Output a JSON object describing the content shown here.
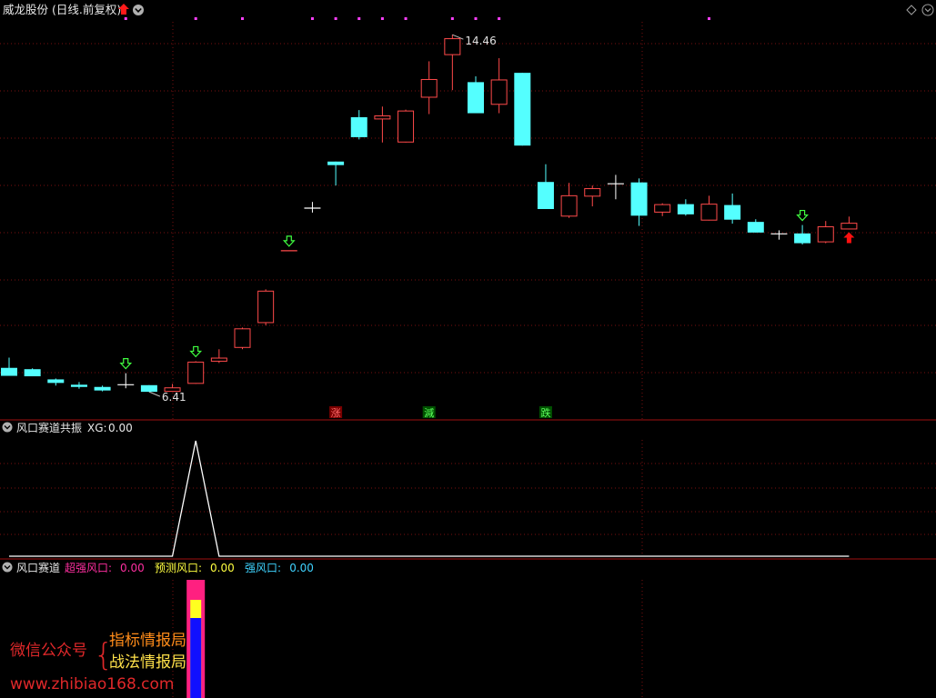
{
  "header": {
    "title": "威龙股份 (日线.前复权)",
    "diamond_icon": "diamond-icon"
  },
  "price_pane": {
    "candles": [
      {
        "o": 6.95,
        "h": 7.18,
        "l": 6.77,
        "c": 6.77
      },
      {
        "o": 6.92,
        "h": 6.94,
        "l": 6.76,
        "c": 6.76
      },
      {
        "o": 6.69,
        "h": 6.71,
        "l": 6.55,
        "c": 6.61
      },
      {
        "o": 6.57,
        "h": 6.63,
        "l": 6.48,
        "c": 6.52
      },
      {
        "o": 6.52,
        "h": 6.55,
        "l": 6.42,
        "c": 6.44
      },
      {
        "o": 6.57,
        "h": 6.83,
        "l": 6.49,
        "c": 6.57
      },
      {
        "o": 6.56,
        "h": 6.56,
        "l": 6.41,
        "c": 6.41
      },
      {
        "o": 6.41,
        "h": 6.59,
        "l": 6.41,
        "c": 6.51
      },
      {
        "o": 6.59,
        "h": 7.1,
        "l": 6.59,
        "c": 7.09
      },
      {
        "o": 7.09,
        "h": 7.37,
        "l": 7.06,
        "c": 7.18
      },
      {
        "o": 7.4,
        "h": 7.86,
        "l": 7.37,
        "c": 7.84
      },
      {
        "o": 7.96,
        "h": 8.72,
        "l": 7.91,
        "c": 8.69
      },
      {
        "o": 9.59,
        "h": 9.59,
        "l": 9.59,
        "c": 9.59
      },
      {
        "o": 10.55,
        "h": 10.69,
        "l": 10.45,
        "c": 10.55
      },
      {
        "o": 11.6,
        "h": 11.6,
        "l": 11.06,
        "c": 11.52
      },
      {
        "o": 12.6,
        "h": 12.76,
        "l": 12.1,
        "c": 12.15
      },
      {
        "o": 12.55,
        "h": 12.84,
        "l": 12.03,
        "c": 12.64
      },
      {
        "o": 12.03,
        "h": 12.77,
        "l": 12.03,
        "c": 12.75
      },
      {
        "o": 13.04,
        "h": 13.86,
        "l": 12.67,
        "c": 13.46
      },
      {
        "o": 14.0,
        "h": 14.46,
        "l": 13.21,
        "c": 14.38
      },
      {
        "o": 13.39,
        "h": 13.52,
        "l": 12.69,
        "c": 12.69
      },
      {
        "o": 12.88,
        "h": 13.93,
        "l": 12.69,
        "c": 13.45
      },
      {
        "o": 13.6,
        "h": 13.6,
        "l": 11.96,
        "c": 11.96
      },
      {
        "o": 11.14,
        "h": 11.54,
        "l": 10.53,
        "c": 10.53
      },
      {
        "o": 10.36,
        "h": 11.12,
        "l": 10.33,
        "c": 10.84
      },
      {
        "o": 10.81,
        "h": 11.06,
        "l": 10.59,
        "c": 11.0
      },
      {
        "o": 11.1,
        "h": 11.3,
        "l": 10.75,
        "c": 11.1
      },
      {
        "o": 11.13,
        "h": 11.22,
        "l": 10.15,
        "c": 10.38
      },
      {
        "o": 10.45,
        "h": 10.66,
        "l": 10.37,
        "c": 10.64
      },
      {
        "o": 10.64,
        "h": 10.75,
        "l": 10.38,
        "c": 10.41
      },
      {
        "o": 10.27,
        "h": 10.83,
        "l": 10.27,
        "c": 10.65
      },
      {
        "o": 10.62,
        "h": 10.88,
        "l": 10.2,
        "c": 10.29
      },
      {
        "o": 10.24,
        "h": 10.3,
        "l": 10.0,
        "c": 10.0
      },
      {
        "o": 9.97,
        "h": 10.05,
        "l": 9.84,
        "c": 9.97
      },
      {
        "o": 9.98,
        "h": 10.17,
        "l": 9.73,
        "c": 9.76
      },
      {
        "o": 9.78,
        "h": 10.26,
        "l": 9.76,
        "c": 10.14
      },
      {
        "o": 10.07,
        "h": 10.36,
        "l": 10.07,
        "c": 10.22
      }
    ],
    "ylim": [
      5.9,
      14.75
    ],
    "high_label": "14.46",
    "low_label": "6.41",
    "signal_down_arrows": [
      5,
      8,
      12,
      34
    ],
    "signal_up_arrows": [
      36
    ],
    "marker_flags": [
      {
        "index": 14,
        "text": "涨",
        "bg": "#7a0000",
        "fg": "#ff6a6a"
      },
      {
        "index": 18,
        "text": "減",
        "bg": "#005000",
        "fg": "#5dff5d"
      },
      {
        "index": 23,
        "text": "跌",
        "bg": "#005000",
        "fg": "#5dff5d"
      }
    ],
    "top_dots": [
      5,
      8,
      10,
      13,
      14,
      15,
      16,
      17,
      19,
      20,
      21,
      30
    ]
  },
  "indicator_pane": {
    "name": "风口赛道共振",
    "xg_label": "XG:",
    "xg_value": "0.00",
    "peak_index": 8,
    "line_values": {
      "base": 0,
      "peak": 1
    }
  },
  "bottom_pane": {
    "name": "风口赛道",
    "legend": [
      {
        "label": "超强风口:",
        "value": "0.00",
        "color": "#ff2fa0"
      },
      {
        "label": "预测风口:",
        "value": "0.00",
        "color": "#ffff40"
      },
      {
        "label": "强风口:",
        "value": "0.00",
        "color": "#3fd3ff"
      }
    ],
    "bar_index": 8
  },
  "watermark": {
    "wechat": "微信公众号",
    "line1": "指标情报局",
    "line2": "战法情报局",
    "url": "www.zhibiao168.com"
  },
  "colors": {
    "up": "#ff4a4a",
    "down": "#54ffff",
    "divider": "#a01010",
    "grid": "#7a1010",
    "arrow_green": "#40ff40",
    "arrow_red": "#ff1010",
    "dot": "#ff40ff"
  }
}
